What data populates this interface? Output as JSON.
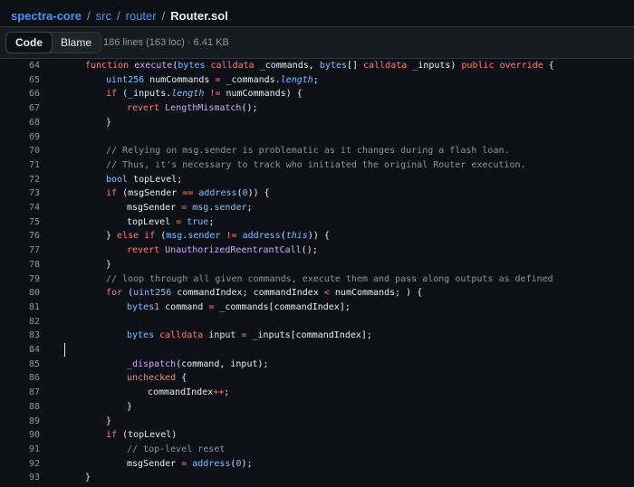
{
  "breadcrumb": {
    "repo": "spectra-core",
    "dir1": "src",
    "dir2": "router",
    "file": "Router.sol",
    "sep": "/"
  },
  "toolbar": {
    "code_tab": "Code",
    "blame_tab": "Blame",
    "file_info": "186 lines (163 loc) · 6.41 KB"
  },
  "code": {
    "lines": [
      {
        "n": "64",
        "indent": 1,
        "tokens": [
          [
            "kw",
            "function "
          ],
          [
            "fn",
            "execute"
          ],
          [
            "",
            "("
          ],
          [
            "ty",
            "bytes "
          ],
          [
            "kw",
            "calldata "
          ],
          [
            "",
            "_commands, "
          ],
          [
            "ty",
            "bytes"
          ],
          [
            "",
            "[] "
          ],
          [
            "kw",
            "calldata "
          ],
          [
            "",
            "_inputs) "
          ],
          [
            "kw",
            "public override "
          ],
          [
            "",
            "{"
          ]
        ]
      },
      {
        "n": "65",
        "indent": 2,
        "tokens": [
          [
            "ty",
            "uint256 "
          ],
          [
            "",
            "numCommands "
          ],
          [
            "kw",
            "= "
          ],
          [
            "",
            "_commands."
          ],
          [
            "ty it",
            "length"
          ],
          [
            "",
            ";"
          ]
        ]
      },
      {
        "n": "66",
        "indent": 2,
        "tokens": [
          [
            "kw",
            "if "
          ],
          [
            "",
            "(_inputs."
          ],
          [
            "ty it",
            "length "
          ],
          [
            "kw",
            "!= "
          ],
          [
            "",
            "numCommands) {"
          ]
        ]
      },
      {
        "n": "67",
        "indent": 3,
        "tokens": [
          [
            "kw",
            "revert "
          ],
          [
            "fn",
            "LengthMismatch"
          ],
          [
            "",
            "();"
          ]
        ]
      },
      {
        "n": "68",
        "indent": 2,
        "tokens": [
          [
            "",
            "}"
          ]
        ]
      },
      {
        "n": "69",
        "indent": 0,
        "tokens": []
      },
      {
        "n": "70",
        "indent": 2,
        "tokens": [
          [
            "cm",
            "// Relying on msg.sender is problematic as it changes during a flash loan."
          ]
        ]
      },
      {
        "n": "71",
        "indent": 2,
        "tokens": [
          [
            "cm",
            "// Thus, it's necessary to track who initiated the original Router execution."
          ]
        ]
      },
      {
        "n": "72",
        "indent": 2,
        "tokens": [
          [
            "ty",
            "bool "
          ],
          [
            "",
            "topLevel;"
          ]
        ]
      },
      {
        "n": "73",
        "indent": 2,
        "tokens": [
          [
            "kw",
            "if "
          ],
          [
            "",
            "(msgSender "
          ],
          [
            "kw",
            "== "
          ],
          [
            "ty",
            "address"
          ],
          [
            "",
            "("
          ],
          [
            "ty",
            "0"
          ],
          [
            "",
            ")) {"
          ]
        ]
      },
      {
        "n": "74",
        "indent": 3,
        "tokens": [
          [
            "",
            "msgSender "
          ],
          [
            "kw",
            "= "
          ],
          [
            "ty",
            "msg"
          ],
          [
            "",
            "."
          ],
          [
            "ty",
            "sender"
          ],
          [
            "",
            ";"
          ]
        ]
      },
      {
        "n": "75",
        "indent": 3,
        "tokens": [
          [
            "",
            "topLevel "
          ],
          [
            "kw",
            "= "
          ],
          [
            "ty",
            "true"
          ],
          [
            "",
            ";"
          ]
        ]
      },
      {
        "n": "76",
        "indent": 2,
        "tokens": [
          [
            "",
            "} "
          ],
          [
            "kw",
            "else if "
          ],
          [
            "",
            "("
          ],
          [
            "ty",
            "msg"
          ],
          [
            "",
            "."
          ],
          [
            "ty",
            "sender "
          ],
          [
            "kw",
            "!= "
          ],
          [
            "ty",
            "address"
          ],
          [
            "",
            "("
          ],
          [
            "ty it",
            "this"
          ],
          [
            "",
            ")) {"
          ]
        ]
      },
      {
        "n": "77",
        "indent": 3,
        "tokens": [
          [
            "kw",
            "revert "
          ],
          [
            "fn",
            "UnauthorizedReentrantCall"
          ],
          [
            "",
            "();"
          ]
        ]
      },
      {
        "n": "78",
        "indent": 2,
        "tokens": [
          [
            "",
            "}"
          ]
        ]
      },
      {
        "n": "79",
        "indent": 2,
        "tokens": [
          [
            "cm",
            "// loop through all given commands, execute them and pass along outputs as defined"
          ]
        ]
      },
      {
        "n": "80",
        "indent": 2,
        "tokens": [
          [
            "kw",
            "for "
          ],
          [
            "",
            "("
          ],
          [
            "ty",
            "uint256 "
          ],
          [
            "",
            "commandIndex; commandIndex "
          ],
          [
            "kw",
            "< "
          ],
          [
            "",
            "numCommands; ) {"
          ]
        ]
      },
      {
        "n": "81",
        "indent": 3,
        "tokens": [
          [
            "ty",
            "bytes1 "
          ],
          [
            "",
            "command "
          ],
          [
            "kw",
            "= "
          ],
          [
            "",
            "_commands[commandIndex];"
          ]
        ]
      },
      {
        "n": "82",
        "indent": 0,
        "tokens": []
      },
      {
        "n": "83",
        "indent": 3,
        "tokens": [
          [
            "ty",
            "bytes "
          ],
          [
            "kw",
            "calldata "
          ],
          [
            "",
            "input "
          ],
          [
            "kw",
            "= "
          ],
          [
            "",
            "_inputs[commandIndex];"
          ]
        ]
      },
      {
        "n": "84",
        "indent": 0,
        "tokens": []
      },
      {
        "n": "85",
        "indent": 3,
        "tokens": [
          [
            "fn",
            "_dispatch"
          ],
          [
            "",
            "(command, input);"
          ]
        ]
      },
      {
        "n": "86",
        "indent": 3,
        "tokens": [
          [
            "kw",
            "unchecked "
          ],
          [
            "",
            "{"
          ]
        ]
      },
      {
        "n": "87",
        "indent": 4,
        "tokens": [
          [
            "",
            "commandIndex"
          ],
          [
            "kw",
            "++"
          ],
          [
            "",
            ";"
          ]
        ]
      },
      {
        "n": "88",
        "indent": 3,
        "tokens": [
          [
            "",
            "}"
          ]
        ]
      },
      {
        "n": "89",
        "indent": 2,
        "tokens": [
          [
            "",
            "}"
          ]
        ]
      },
      {
        "n": "90",
        "indent": 2,
        "tokens": [
          [
            "kw",
            "if "
          ],
          [
            "",
            "(topLevel)"
          ]
        ]
      },
      {
        "n": "91",
        "indent": 3,
        "tokens": [
          [
            "cm",
            "// top-level reset"
          ]
        ]
      },
      {
        "n": "92",
        "indent": 3,
        "tokens": [
          [
            "",
            "msgSender "
          ],
          [
            "kw",
            "= "
          ],
          [
            "ty",
            "address"
          ],
          [
            "",
            "("
          ],
          [
            "ty",
            "0"
          ],
          [
            "",
            ");"
          ]
        ]
      },
      {
        "n": "93",
        "indent": 1,
        "tokens": [
          [
            "",
            "}"
          ]
        ]
      }
    ]
  }
}
